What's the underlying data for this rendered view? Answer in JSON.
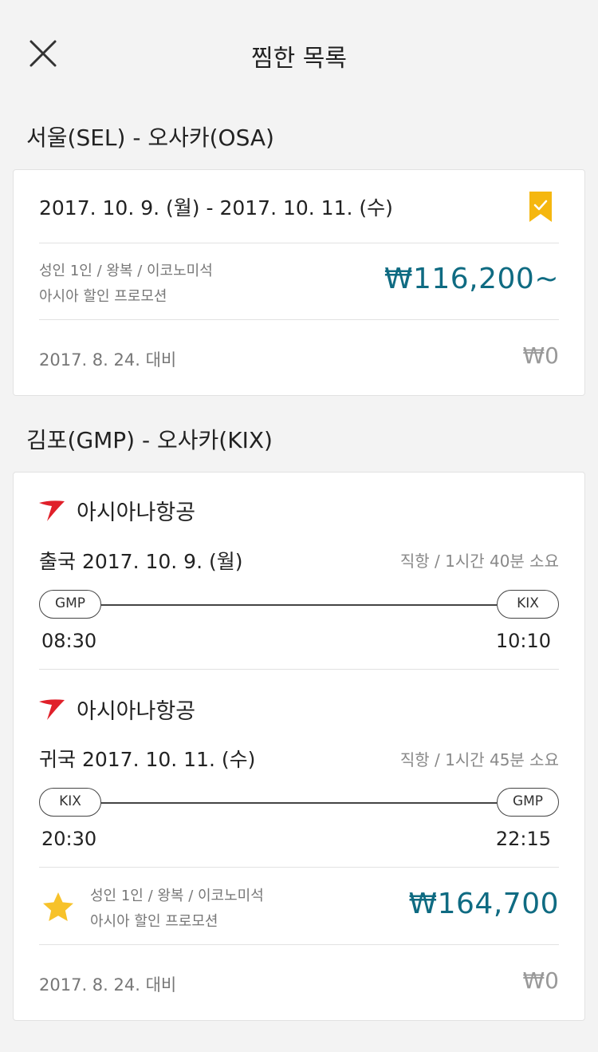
{
  "header": {
    "title": "찜한 목록"
  },
  "sections": [
    {
      "title": "서울(SEL) - 오사카(OSA)",
      "card": {
        "dates": "2017. 10. 9. (월) - 2017. 10. 11. (수)",
        "bookmarked": true,
        "passenger_info": "성인 1인 / 왕복 / 이코노미석",
        "promotion": "아시아 할인 프로모션",
        "price": "₩116,200~",
        "compare_date": "2017. 8. 24. 대비",
        "compare_value": "₩0"
      }
    },
    {
      "title": "김포(GMP) - 오사카(KIX)",
      "card": {
        "legs": [
          {
            "airline": "아시아나항공",
            "title": "출국 2017. 10. 9. (월)",
            "meta": "직항 / 1시간 40분 소요",
            "from": "GMP",
            "to": "KIX",
            "depart": "08:30",
            "arrive": "10:10"
          },
          {
            "airline": "아시아나항공",
            "title": "귀국 2017. 10. 11. (수)",
            "meta": "직항 / 1시간 45분 소요",
            "from": "KIX",
            "to": "GMP",
            "depart": "20:30",
            "arrive": "22:15"
          }
        ],
        "favorite": true,
        "passenger_info": "성인 1인 / 왕복 / 이코노미석",
        "promotion": "아시아 할인 프로모션",
        "price": "₩164,700",
        "compare_date": "2017. 8. 24. 대비",
        "compare_value": "₩0"
      }
    }
  ],
  "colors": {
    "accent": "#0f6b82",
    "bookmark": "#f5b70f",
    "star": "#f7c22a",
    "airline_logo": "#e0202a"
  },
  "icons": {
    "close": "close-icon",
    "bookmark": "bookmark-check-icon",
    "star": "star-icon",
    "airline": "asiana-logo-icon"
  }
}
